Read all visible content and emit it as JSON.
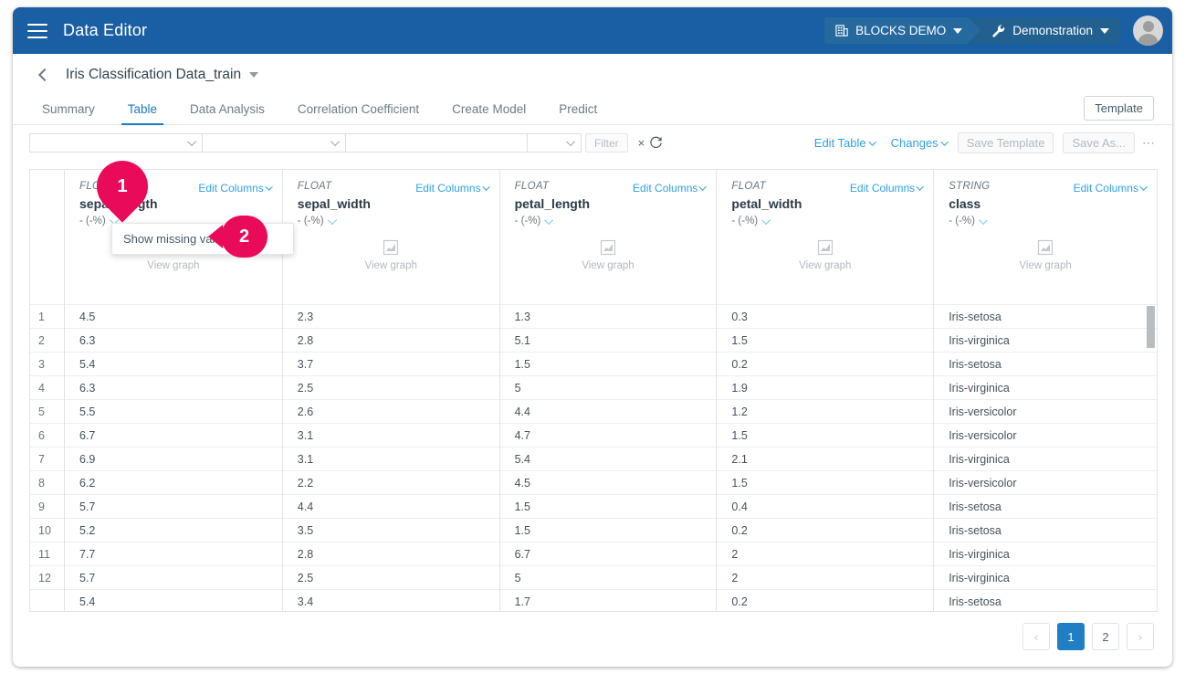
{
  "topbar": {
    "menu_icon": "hamburger-icon",
    "app_title": "Data Editor",
    "workspace": {
      "icon": "building-icon",
      "label": "BLOCKS DEMO"
    },
    "project": {
      "icon": "wrench-icon",
      "label": "Demonstration"
    },
    "avatar": "user-avatar"
  },
  "title_row": {
    "back_icon": "chevron-left-icon",
    "title": "Iris Classification Data_train",
    "caret_icon": "caret-down-icon"
  },
  "tabs": [
    {
      "label": "Summary",
      "active": false
    },
    {
      "label": "Table",
      "active": true
    },
    {
      "label": "Data Analysis",
      "active": false
    },
    {
      "label": "Correlation Coefficient",
      "active": false
    },
    {
      "label": "Create Model",
      "active": false
    },
    {
      "label": "Predict",
      "active": false
    }
  ],
  "template_button": "Template",
  "toolbar": {
    "select1": "",
    "select2": "",
    "select3": "",
    "select4": "",
    "filter_button": "Filter",
    "clear_icon": "×",
    "refresh_icon": "refresh-icon",
    "edit_table": "Edit Table",
    "changes": "Changes",
    "save_template": "Save Template",
    "save_as": "Save As...",
    "more": "⋯"
  },
  "context_menu": {
    "items": [
      "Show missing values"
    ]
  },
  "markers": [
    {
      "id": "1",
      "shape": "pin"
    },
    {
      "id": "2",
      "shape": "callout"
    }
  ],
  "table": {
    "edit_columns_label": "Edit Columns",
    "view_graph_label": "View graph",
    "stat_label": "- (-%)",
    "columns": [
      {
        "type": "FLOAT",
        "name": "sepal_length"
      },
      {
        "type": "FLOAT",
        "name": "sepal_width"
      },
      {
        "type": "FLOAT",
        "name": "petal_length"
      },
      {
        "type": "FLOAT",
        "name": "petal_width"
      },
      {
        "type": "STRING",
        "name": "class"
      }
    ],
    "row_numbers": [
      "1",
      "2",
      "3",
      "4",
      "5",
      "6",
      "7",
      "8",
      "9",
      "10",
      "11",
      "12"
    ],
    "rows": [
      [
        "4.5",
        "2.3",
        "1.3",
        "0.3",
        "Iris-setosa"
      ],
      [
        "6.3",
        "2.8",
        "5.1",
        "1.5",
        "Iris-virginica"
      ],
      [
        "5.4",
        "3.7",
        "1.5",
        "0.2",
        "Iris-setosa"
      ],
      [
        "6.3",
        "2.5",
        "5",
        "1.9",
        "Iris-virginica"
      ],
      [
        "5.5",
        "2.6",
        "4.4",
        "1.2",
        "Iris-versicolor"
      ],
      [
        "6.7",
        "3.1",
        "4.7",
        "1.5",
        "Iris-versicolor"
      ],
      [
        "6.9",
        "3.1",
        "5.4",
        "2.1",
        "Iris-virginica"
      ],
      [
        "6.2",
        "2.2",
        "4.5",
        "1.5",
        "Iris-versicolor"
      ],
      [
        "5.7",
        "4.4",
        "1.5",
        "0.4",
        "Iris-setosa"
      ],
      [
        "5.2",
        "3.5",
        "1.5",
        "0.2",
        "Iris-setosa"
      ],
      [
        "7.7",
        "2.8",
        "6.7",
        "2",
        "Iris-virginica"
      ],
      [
        "5.7",
        "2.5",
        "5",
        "2",
        "Iris-virginica"
      ],
      [
        "5.4",
        "3.4",
        "1.7",
        "0.2",
        "Iris-setosa"
      ]
    ]
  },
  "pagination": {
    "prev": "‹",
    "pages": [
      "1",
      "2"
    ],
    "current": "1",
    "next": "›"
  },
  "colors": {
    "header_blue": "#1a5fa4",
    "accent_blue": "#1b7bbd",
    "link_blue": "#31a0e6",
    "marker_pink": "#ea0a5a"
  }
}
